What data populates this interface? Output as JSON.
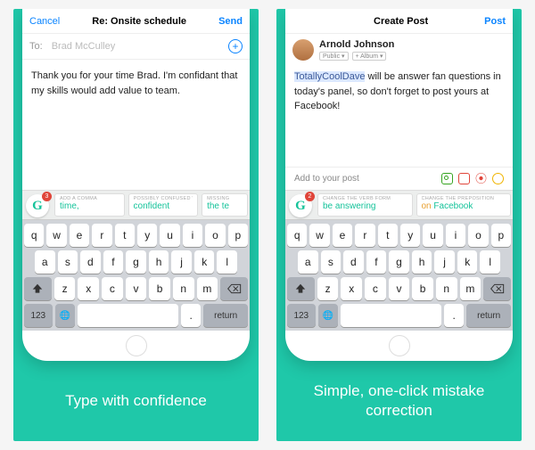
{
  "left": {
    "nav": {
      "cancel": "Cancel",
      "title": "Re: Onsite schedule",
      "send": "Send"
    },
    "to": {
      "label": "To:",
      "name": "Brad McCulley"
    },
    "body": "Thank you for your time Brad. I'm confidant that my skills would add value to team.",
    "badge": "3",
    "suggestions": [
      {
        "tag": "ADD A COMMA",
        "val": "time,"
      },
      {
        "tag": "POSSIBLY CONFUSED WORD",
        "val": "confident"
      },
      {
        "tag": "MISSING",
        "val": "the te"
      }
    ],
    "caption": "Type with confidence"
  },
  "right": {
    "nav": {
      "back": "",
      "title": "Create Post",
      "post": "Post"
    },
    "user": "Arnold Johnson",
    "meta": [
      "Public ▾",
      "+ Album ▾"
    ],
    "body": {
      "hl": "TotallyCoolDave",
      "rest": " will be answer fan questions in today's panel, so don't forget to post yours at Facebook!"
    },
    "addrow": "Add to your post",
    "badge": "2",
    "suggestions": [
      {
        "tag": "CHANGE THE VERB FORM",
        "val": "be answering"
      },
      {
        "tag": "CHANGE THE PREPOSITION",
        "pre": "on ",
        "val": "Facebook"
      }
    ],
    "caption": "Simple, one-click mistake correction"
  },
  "keyboard": {
    "r1": [
      "q",
      "w",
      "e",
      "r",
      "t",
      "y",
      "u",
      "i",
      "o",
      "p"
    ],
    "r2": [
      "a",
      "s",
      "d",
      "f",
      "g",
      "h",
      "j",
      "k",
      "l"
    ],
    "r3": [
      "z",
      "x",
      "c",
      "v",
      "b",
      "n",
      "m"
    ],
    "num": "123",
    "globe": "🌐",
    "dot": ".",
    "ret": "return"
  }
}
